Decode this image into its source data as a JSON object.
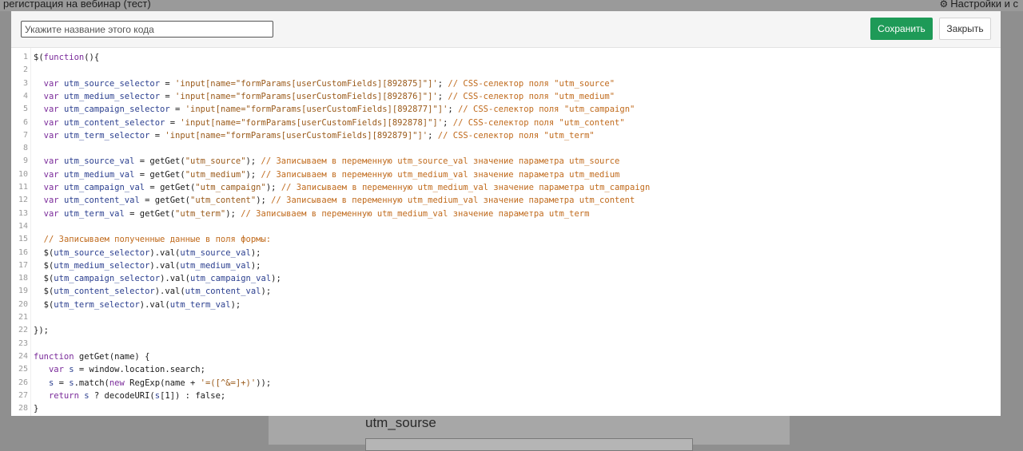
{
  "background": {
    "title": "регистрация на вебинар (тест)",
    "settings_label": "Настройки и с",
    "field_label": "utm_sourse"
  },
  "modal": {
    "name_placeholder": "Укажите название этого кода",
    "name_value": "",
    "save_label": "Сохранить",
    "close_label": "Закрыть"
  },
  "code": {
    "lines": [
      "$(function(){",
      "",
      "  var utm_source_selector = 'input[name=\"formParams[userCustomFields][892875]\"]'; // CSS-селектор поля \"utm_source\"",
      "  var utm_medium_selector = 'input[name=\"formParams[userCustomFields][892876]\"]'; // CSS-селектор поля \"utm_medium\"",
      "  var utm_campaign_selector = 'input[name=\"formParams[userCustomFields][892877]\"]'; // CSS-селектор поля \"utm_campaign\"",
      "  var utm_content_selector = 'input[name=\"formParams[userCustomFields][892878]\"]'; // CSS-селектор поля \"utm_content\"",
      "  var utm_term_selector = 'input[name=\"formParams[userCustomFields][892879]\"]'; // CSS-селектор поля \"utm_term\"",
      "",
      "  var utm_source_val = getGet(\"utm_source\"); // Записываем в переменную utm_source_val значение параметра utm_source",
      "  var utm_medium_val = getGet(\"utm_medium\"); // Записываем в переменную utm_medium_val значение параметра utm_medium",
      "  var utm_campaign_val = getGet(\"utm_campaign\"); // Записываем в переменную utm_medium_val значение параметра utm_campaign",
      "  var utm_content_val = getGet(\"utm_content\"); // Записываем в переменную utm_medium_val значение параметра utm_content",
      "  var utm_term_val = getGet(\"utm_term\"); // Записываем в переменную utm_medium_val значение параметра utm_term",
      "",
      "  // Записываем полученные данные в поля формы:",
      "  $(utm_source_selector).val(utm_source_val);",
      "  $(utm_medium_selector).val(utm_medium_val);",
      "  $(utm_campaign_selector).val(utm_campaign_val);",
      "  $(utm_content_selector).val(utm_content_val);",
      "  $(utm_term_selector).val(utm_term_val);",
      "",
      "});",
      "",
      "function getGet(name) {",
      "   var s = window.location.search;",
      "   s = s.match(new RegExp(name + '=([^&=]+)'));",
      "   return s ? decodeURI(s[1]) : false;",
      "}"
    ]
  },
  "colors": {
    "save_button": "#1e9a57",
    "keyword": "#7a2a9a",
    "variable": "#2b3f8f",
    "string": "#9a5a1a",
    "comment": "#c06a1c"
  }
}
